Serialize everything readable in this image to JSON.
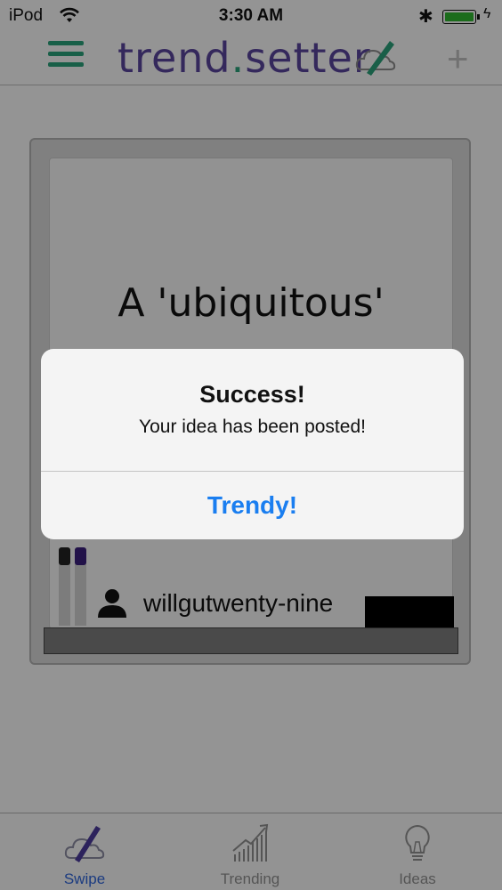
{
  "status_bar": {
    "carrier": "iPod",
    "time": "3:30 AM"
  },
  "nav": {
    "brand_prefix": "trend",
    "brand_dot": ".",
    "brand_suffix": "setter",
    "add_label": "+"
  },
  "card": {
    "idea_text": "A 'ubiquitous'",
    "author": "willgutwenty-nine"
  },
  "tabs": [
    {
      "label": "Swipe",
      "active": true
    },
    {
      "label": "Trending",
      "active": false
    },
    {
      "label": "Ideas",
      "active": false
    }
  ],
  "alert": {
    "title": "Success!",
    "message": "Your idea has been posted!",
    "button_label": "Trendy!"
  },
  "colors": {
    "brand_purple": "#58439a",
    "brand_green": "#2b9f78",
    "active_tab": "#2e63d6",
    "alert_button": "#1a7ef0",
    "battery": "#2fb52f"
  }
}
